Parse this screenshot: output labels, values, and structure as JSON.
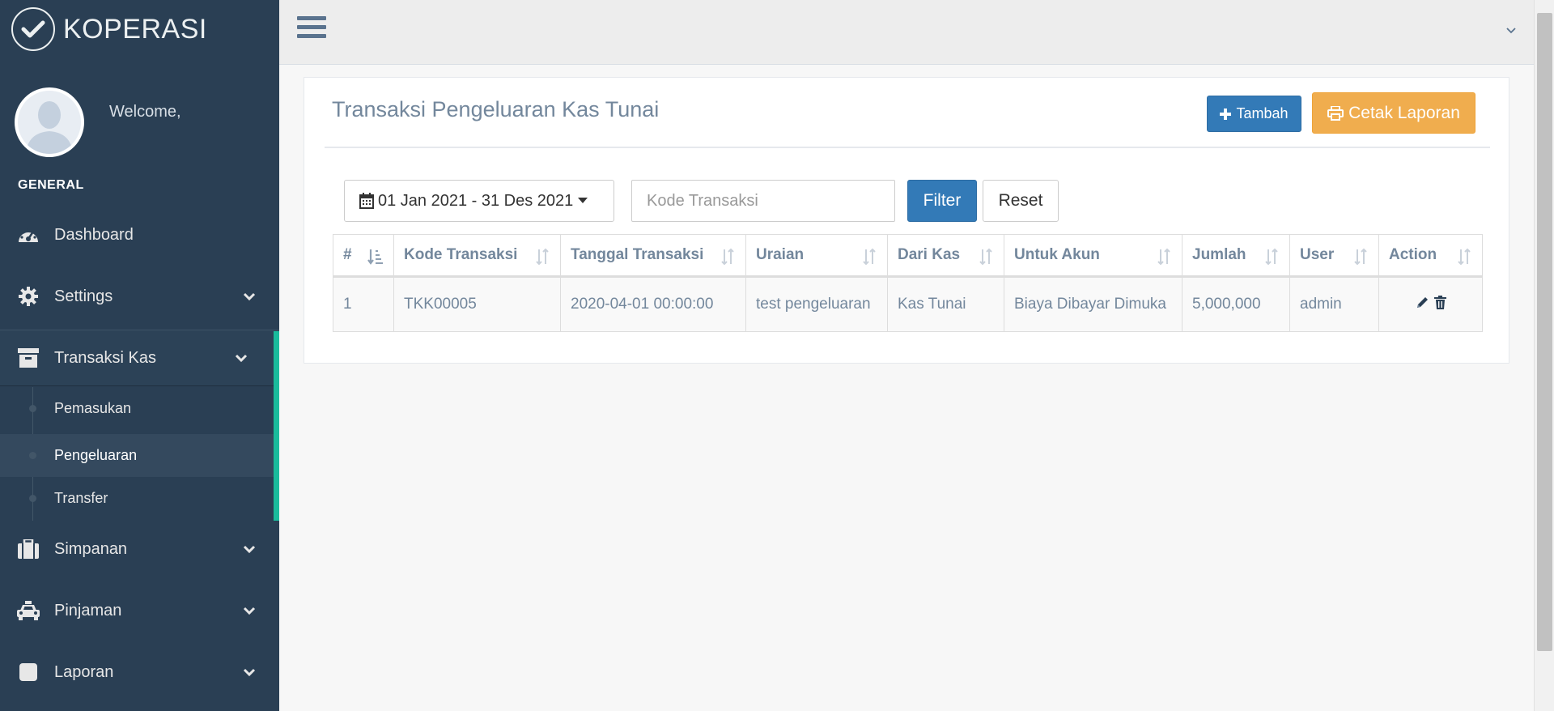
{
  "brand": {
    "name": "KOPERASI"
  },
  "user": {
    "welcome": "Welcome,"
  },
  "sidebar": {
    "section": "GENERAL",
    "items": [
      {
        "label": "Dashboard",
        "icon": "dashboard-icon"
      },
      {
        "label": "Settings",
        "icon": "gear-icon"
      },
      {
        "label": "Transaksi Kas",
        "icon": "archive-icon"
      },
      {
        "label": "Simpanan",
        "icon": "briefcase-icon"
      },
      {
        "label": "Pinjaman",
        "icon": "taxi-icon"
      },
      {
        "label": "Laporan",
        "icon": "square-icon"
      }
    ],
    "subitems": [
      {
        "label": "Pemasukan"
      },
      {
        "label": "Pengeluaran"
      },
      {
        "label": "Transfer"
      }
    ]
  },
  "panel": {
    "title": "Transaksi Pengeluaran Kas Tunai",
    "tambah_label": "Tambah",
    "cetak_label": "Cetak Laporan"
  },
  "filter": {
    "date_range": "01 Jan 2021 - 31 Des 2021",
    "kode_placeholder": "Kode Transaksi",
    "filter_label": "Filter",
    "reset_label": "Reset"
  },
  "table": {
    "headers": [
      "#",
      "Kode Transaksi",
      "Tanggal Transaksi",
      "Uraian",
      "Dari Kas",
      "Untuk Akun",
      "Jumlah",
      "User",
      "Action"
    ],
    "rows": [
      [
        "1",
        "TKK00005",
        "2020-04-01 00:00:00",
        "test pengeluaran",
        "Kas Tunai",
        "Biaya Dibayar Dimuka",
        "5,000,000",
        "admin"
      ]
    ]
  },
  "colors": {
    "sidebar": "#2a3f54",
    "accent_green": "#1ABB9C",
    "primary": "#337ab7",
    "warning": "#f0ad4e"
  }
}
